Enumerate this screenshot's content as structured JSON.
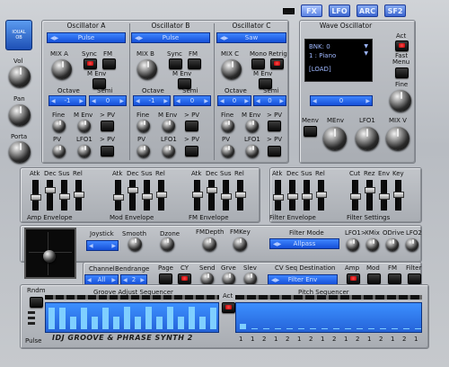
{
  "tabs": [
    "FX",
    "LFO",
    "ARC",
    "SF2"
  ],
  "logo": {
    "text": "IOUAL OB"
  },
  "left": {
    "vol": "Vol",
    "pan": "Pan",
    "porta": "Porta"
  },
  "oscA": {
    "title": "Oscillator A",
    "wave": "Pulse",
    "mix": "MIX A",
    "sync": "Sync",
    "fm": "FM",
    "menv": "M Env",
    "octave": "Octave",
    "semi": "Semi",
    "oct_val": "-1",
    "semi_val": "0",
    "fine": "Fine",
    "menv2": "M Env",
    "pv_btn": "> PV",
    "pv": "PV",
    "lfo1": "LFO1",
    "pv_btn2": "> PV"
  },
  "oscB": {
    "title": "Oscillator B",
    "wave": "Pulse",
    "mix": "MIX B",
    "sync": "Sync",
    "fm": "FM",
    "menv": "M Env",
    "octave": "Octave",
    "semi": "Semi",
    "oct_val": "-1",
    "semi_val": "0",
    "fine": "Fine",
    "menv2": "M Env",
    "pv_btn": "> PV",
    "pv": "PV",
    "lfo1": "LFO1",
    "pv_btn2": "> PV"
  },
  "oscC": {
    "title": "Oscillator C",
    "wave": "Saw",
    "mix": "MIX C",
    "mono": "Mono",
    "retrig": "Retrig",
    "menv": "M Env",
    "octave": "Octave",
    "semi": "Semi",
    "oct_val": "0",
    "semi_val": "0",
    "fine": "Fine",
    "menv2": "M Env",
    "pv_btn": "> PV",
    "pv": "PV",
    "lfo1": "LFO1",
    "pv_btn2": "> PV"
  },
  "wave": {
    "title": "Wave Oscillator",
    "line1": "BNK: 0",
    "line2": "1 : Piano",
    "load": "[LOAD]",
    "act": "Act",
    "fastmenu1": "Fast",
    "fastmenu2": "Menu",
    "fine": "Fine",
    "counter": "0",
    "menv": "Menv",
    "menv2": "MEnv",
    "lfo1": "LFO1",
    "mixv": "MIX V"
  },
  "env": {
    "amp": "Amp Envelope",
    "mod": "Mod Envelope",
    "fm": "FM Envelope",
    "filter": "Filter Envelope",
    "filtset": "Filter Settings",
    "atk": "Atk",
    "dec": "Dec",
    "sus": "Sus",
    "rel": "Rel",
    "cut": "Cut",
    "rez": "Rez",
    "envl": "Env",
    "key": "Key"
  },
  "joy": {
    "joystick": "Joystick",
    "smooth": "Smooth",
    "dzone": "Dzone",
    "fmdepth": "FMDepth",
    "fmkey": "FMKey",
    "filtermode": "Filter Mode",
    "filtermode_val": "Allpass",
    "lfo1x": "LFO1>",
    "xmix": "XMix",
    "odrive": "ODrive",
    "lfo2": "LFO2"
  },
  "seqctl": {
    "channel": "Channel",
    "bend": "Bendrange",
    "channel_val": "All",
    "bend_val": "2",
    "page": "Page",
    "cy": "CY",
    "send": "Send",
    "grve": "Grve",
    "slev": "Slev",
    "cvseq": "CV Seq Destination",
    "cvseq_val": "Filter Env",
    "amp": "Amp",
    "mod": "Mod",
    "fm": "FM",
    "filter": "Filter"
  },
  "seq": {
    "rndm": "Rndm",
    "pulse": "Pulse",
    "groove": "Groove Adjust Sequencer",
    "pitch": "Pitch Sequencer",
    "act": "Act",
    "groove_vals": [
      0.85,
      0.85,
      0.5,
      0.85,
      0.5,
      0.85,
      0.5,
      0.9,
      0.5,
      0.9,
      0.5,
      0.9,
      0.5,
      0.9,
      0.5,
      0.85
    ],
    "pitch_vals": [
      0.2,
      0.05,
      0.05,
      0.05,
      0.05,
      0.05,
      0.05,
      0.05,
      0.05,
      0.05,
      0.05,
      0.05,
      0.05,
      0.05,
      0.05,
      0.05
    ],
    "pitch_nums": [
      "1",
      "1",
      "2",
      "1",
      "2",
      "1",
      "2",
      "1",
      "2",
      "1",
      "2",
      "1",
      "2",
      "1",
      "2",
      "1"
    ],
    "brand": "IDJ GROOVE & PHRASE SYNTH 2"
  }
}
